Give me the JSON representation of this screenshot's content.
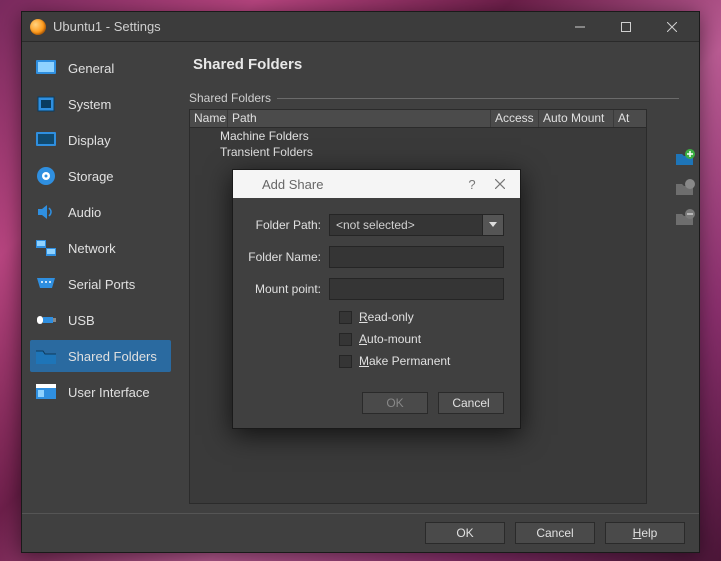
{
  "window": {
    "title": "Ubuntu1 - Settings"
  },
  "sidebar": {
    "items": [
      {
        "label": "General"
      },
      {
        "label": "System"
      },
      {
        "label": "Display"
      },
      {
        "label": "Storage"
      },
      {
        "label": "Audio"
      },
      {
        "label": "Network"
      },
      {
        "label": "Serial Ports"
      },
      {
        "label": "USB"
      },
      {
        "label": "Shared Folders"
      },
      {
        "label": "User Interface"
      }
    ],
    "active_index": 8
  },
  "main": {
    "title": "Shared Folders",
    "group": "Shared Folders",
    "columns": {
      "name": "Name",
      "path": "Path",
      "access": "Access",
      "automount": "Auto Mount",
      "at": "At"
    },
    "rows": [
      {
        "label": "Machine Folders"
      },
      {
        "label": "Transient Folders"
      }
    ]
  },
  "dialog": {
    "title": "Add Share",
    "folder_path_label": "Folder Path:",
    "folder_path_value": "<not selected>",
    "folder_name_label": "Folder Name:",
    "folder_name_value": "",
    "mount_point_label": "Mount point:",
    "mount_point_value": "",
    "readonly_label": "Read-only",
    "automount_label": "Auto-mount",
    "permanent_label": "Make Permanent",
    "ok": "OK",
    "cancel": "Cancel"
  },
  "footer": {
    "ok": "OK",
    "cancel": "Cancel",
    "help": "Help"
  }
}
